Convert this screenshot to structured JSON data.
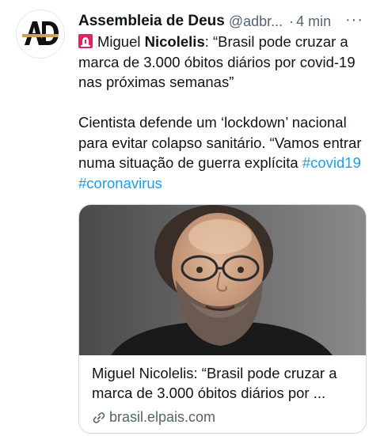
{
  "tweet": {
    "author_name": "Assembleia de Deus",
    "handle": "@adbr...",
    "separator": "·",
    "time": "4 min",
    "more_label": "···",
    "avatar_text": "AD",
    "body_line1_plain": "Miguel ",
    "body_line1_bold": "Nicolelis",
    "body_line1_rest": ": “Brasil pode cruzar a marca de 3.000 óbitos diários por covid-19 nas próximas semanas”",
    "body_paragraph2": "Cientista defende um ‘lockdown’ nacional para evitar colapso sanitário. “Vamos entrar numa situação de guerra explícita ",
    "hashtags": [
      "#covid19",
      "#coronavirus"
    ]
  },
  "card": {
    "title": "Miguel Nicolelis: “Brasil pode cruzar a marca de 3.000 óbitos diários por ...",
    "domain": "brasil.elpais.com"
  },
  "colors": {
    "link_blue": "#1d9bf0",
    "secondary_text": "#536471",
    "card_border": "#cfd9de"
  },
  "icons": [
    "siren-emoji-icon",
    "link-icon",
    "more-options-icon"
  ]
}
